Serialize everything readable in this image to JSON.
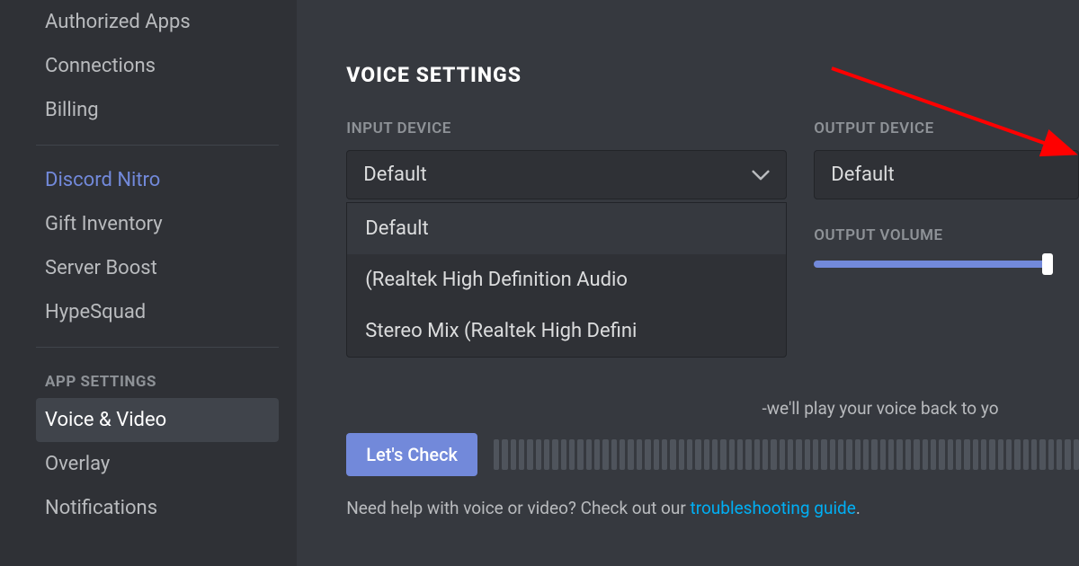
{
  "sidebar": {
    "items": [
      {
        "label": "Authorized Apps"
      },
      {
        "label": "Connections"
      },
      {
        "label": "Billing"
      },
      {
        "label": "Discord Nitro"
      },
      {
        "label": "Gift Inventory"
      },
      {
        "label": "Server Boost"
      },
      {
        "label": "HypeSquad"
      }
    ],
    "app_settings_header": "APP SETTINGS",
    "app_items": [
      {
        "label": "Voice & Video"
      },
      {
        "label": "Overlay"
      },
      {
        "label": "Notifications"
      }
    ]
  },
  "section_title": "VOICE SETTINGS",
  "input_device": {
    "label": "INPUT DEVICE",
    "selected": "Default",
    "options": [
      "Default",
      "(Realtek High Definition Audio",
      "Stereo Mix (Realtek High Defini"
    ]
  },
  "output_device": {
    "label": "OUTPUT DEVICE",
    "selected": "Default"
  },
  "output_volume_label": "OUTPUT VOLUME",
  "mic_hint": "-we'll play your voice back to yo",
  "lets_check": "Let's Check",
  "help_prefix": "Need help with voice or video? Check out our ",
  "help_link": "troubleshooting guide",
  "help_suffix": "."
}
